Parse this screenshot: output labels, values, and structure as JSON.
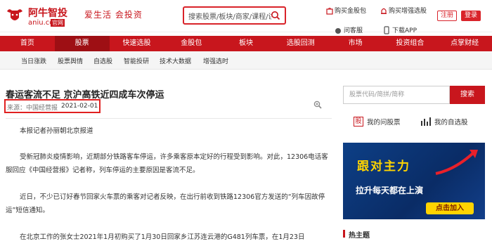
{
  "header": {
    "brand": "阿牛智投",
    "domain": "aniu.com",
    "badge": "官网",
    "slogan": "爱生活 会投资",
    "search_placeholder": "搜索股票/板块/商家/课程/讲",
    "links": [
      "购买金股包",
      "购买增强选股",
      "问客服",
      "下载APP"
    ],
    "register": "注册",
    "login": "登录"
  },
  "nav": {
    "items": [
      "首页",
      "股票",
      "快速选股",
      "金股包",
      "板块",
      "选股回测",
      "市场",
      "投资组合",
      "点掌财经"
    ],
    "active_index": 1
  },
  "subnav": {
    "items": [
      "当日涨跌",
      "股票舆情",
      "自选股",
      "智能投研",
      "技术大数据",
      "增强选时"
    ]
  },
  "article": {
    "title": "春运客流不足 京沪高铁近四成车次停运",
    "source": "来源：中国经营报",
    "date": "2021-02-01",
    "paragraphs": [
      "本报记者孙丽朝北京报道",
      "受新冠肺炎疫情影响，近期部分铁路客车停运，许多乘客原本定好的行程受到影响。对此，12306电话客服回应《中国经营报》记者称，列车停运的主要原因是客流不足。",
      "近日，不少已订好春节回家火车票的乘客对记者反映，在出行前收到铁路12306官方发送的“列车因故停运”短信通知。",
      "在北京工作的张女士2021年1月初购买了1月30日回家乡江苏连云港的G481列车票，在1月23日"
    ]
  },
  "sidebar": {
    "search_placeholder": "股票代码/简拼/简称",
    "search_button": "搜索",
    "my_stocks": "我的问股票",
    "my_watchlist": "我的自选股",
    "stock_icon_char": "股",
    "ad_title": "跟对主力",
    "ad_subtitle": "拉升每天都在上演",
    "ad_button": "点击加入",
    "hot_topics": "热主题"
  },
  "colors": {
    "brand_red": "#c8161d",
    "ad_blue": "#0d3f86",
    "ad_yellow": "#ffd400"
  }
}
